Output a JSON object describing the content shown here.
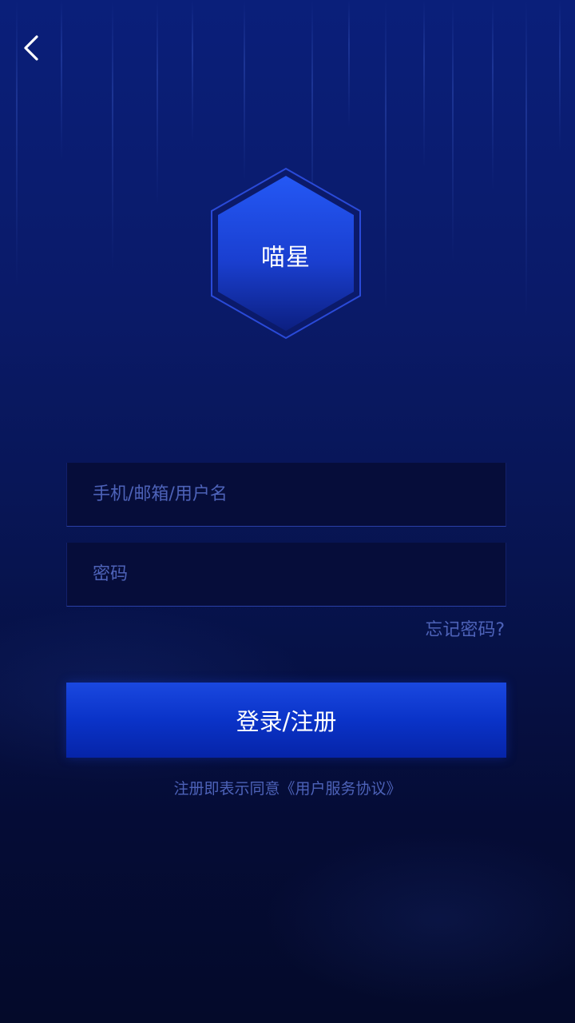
{
  "header": {
    "back_icon": "chevron-left-icon"
  },
  "logo": {
    "text": "喵星",
    "shape": "hexagon",
    "accent": "#1f4ef0"
  },
  "form": {
    "username_placeholder": "手机/邮箱/用户名",
    "username_value": "",
    "password_placeholder": "密码",
    "password_value": "",
    "forgot_label": "忘记密码?"
  },
  "actions": {
    "login_register_label": "登录/注册"
  },
  "footer": {
    "agreement_text": "注册即表示同意《用户服务协议》"
  },
  "colors": {
    "background_top": "#0a1f7a",
    "background_bottom": "#040a2a",
    "button": "#0a33c8",
    "muted_text": "#4d62b8"
  }
}
